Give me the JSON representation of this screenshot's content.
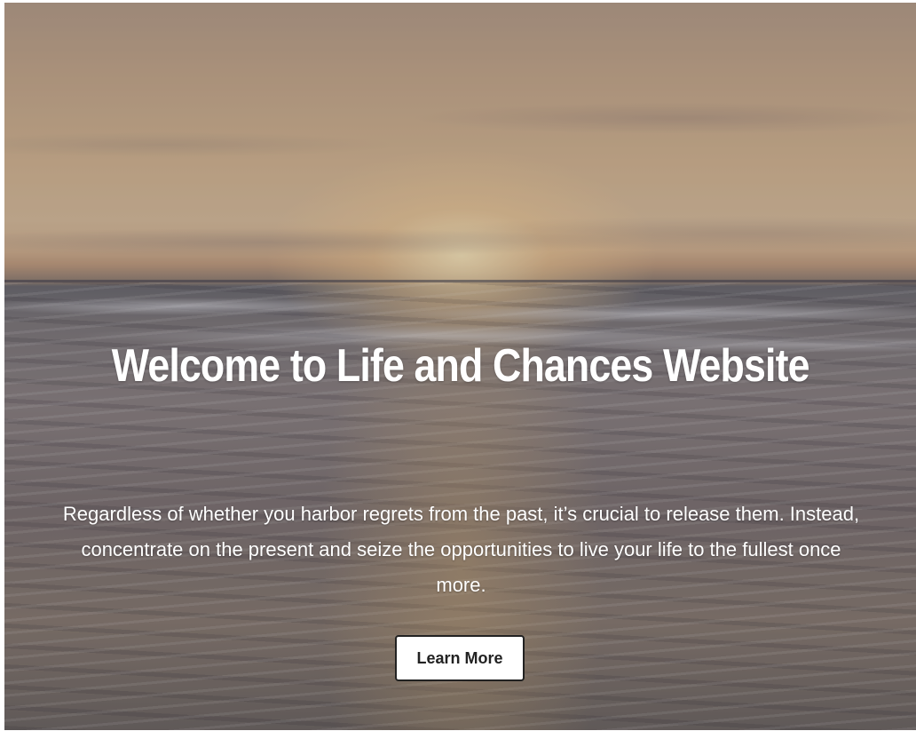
{
  "hero": {
    "title": "Welcome to Life and Chances Website",
    "subtitle": "Regardless of whether you harbor regrets from the past, it’s crucial to release them. Instead, concentrate on the present and seize the opportunities to live your life to the fullest once more.",
    "button_label": "Learn More",
    "background_image": "sunset-ocean-waves",
    "colors": {
      "text": "#ffffff",
      "button_bg": "#ffffff",
      "button_text": "#222222"
    }
  }
}
